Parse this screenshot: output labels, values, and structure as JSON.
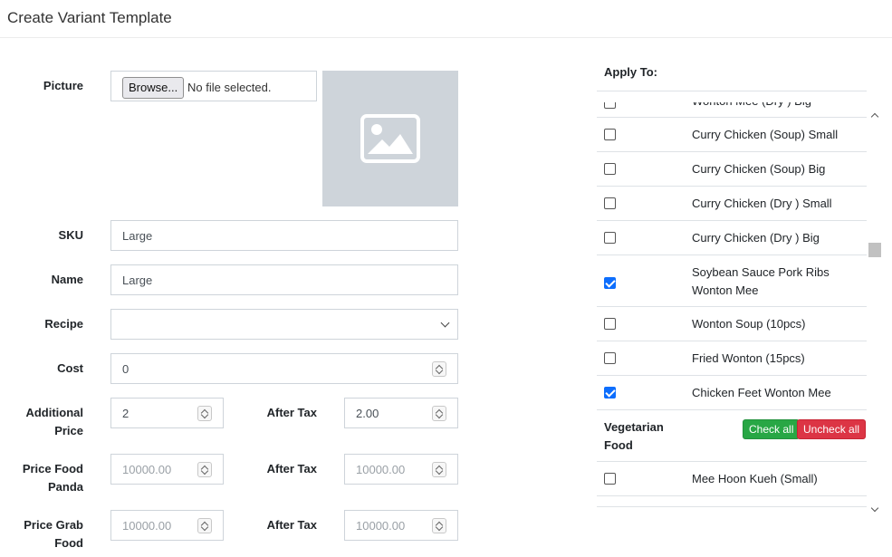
{
  "page": {
    "title": "Create Variant Template"
  },
  "form": {
    "picture_label": "Picture",
    "browse_label": "Browse...",
    "file_status": "No file selected.",
    "sku_label": "SKU",
    "sku_value": "Large",
    "name_label": "Name",
    "name_value": "Large",
    "recipe_label": "Recipe",
    "recipe_value": "",
    "cost_label": "Cost",
    "cost_value": "0",
    "additional_price_label_1": "Additional",
    "additional_price_label_2": "Price",
    "additional_price_value": "2",
    "additional_after_tax_label": "After Tax",
    "additional_after_tax_value": "2.00",
    "price_foodpanda_label_1": "Price Food",
    "price_foodpanda_label_2": "Panda",
    "price_foodpanda_placeholder": "10000.00",
    "foodpanda_after_tax_label": "After Tax",
    "foodpanda_after_tax_placeholder": "10000.00",
    "price_grab_label_1": "Price Grab",
    "price_grab_label_2": "Food",
    "price_grab_placeholder": "10000.00",
    "grab_after_tax_label": "After Tax",
    "grab_after_tax_placeholder": "10000.00"
  },
  "apply_to": {
    "title": "Apply To:",
    "items": [
      {
        "label": "Wonton Mee (Dry ) Big",
        "checked": false
      },
      {
        "label": "Curry Chicken (Soup) Small",
        "checked": false
      },
      {
        "label": "Curry Chicken (Soup) Big",
        "checked": false
      },
      {
        "label": "Curry Chicken (Dry ) Small",
        "checked": false
      },
      {
        "label": "Curry Chicken (Dry ) Big",
        "checked": false
      },
      {
        "label": "Soybean Sauce Pork Ribs Wonton Mee",
        "checked": true
      },
      {
        "label": "Wonton Soup (10pcs)",
        "checked": false
      },
      {
        "label": "Fried Wonton (15pcs)",
        "checked": false
      },
      {
        "label": "Chicken Feet Wonton Mee",
        "checked": true
      }
    ],
    "group": {
      "title": "Vegetarian Food",
      "check_all_label": "Check all",
      "uncheck_all_label": "Uncheck all",
      "items": [
        {
          "label": "Mee Hoon Kueh (Small)",
          "checked": false
        }
      ]
    }
  },
  "colors": {
    "check_all": "#28a745",
    "uncheck_all": "#dc3545",
    "checkbox_checked": "#0d6efd",
    "image_placeholder": "#ced4da"
  }
}
